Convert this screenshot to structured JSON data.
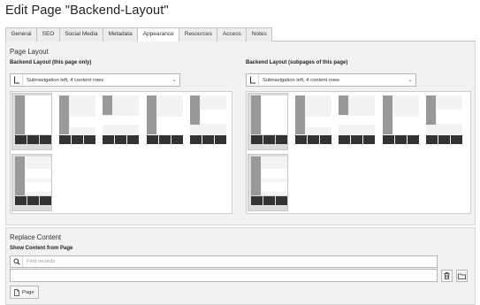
{
  "page": {
    "title": "Edit Page \"Backend-Layout\""
  },
  "tabs": [
    {
      "label": "General",
      "active": false
    },
    {
      "label": "SEO",
      "active": false
    },
    {
      "label": "Social Media",
      "active": false
    },
    {
      "label": "Metadata",
      "active": false
    },
    {
      "label": "Appearance",
      "active": true
    },
    {
      "label": "Resources",
      "active": false
    },
    {
      "label": "Access",
      "active": false
    },
    {
      "label": "Notes",
      "active": false
    }
  ],
  "page_layout": {
    "section_title": "Page Layout",
    "this_page": {
      "label": "Backend Layout (this page only)",
      "selected": "Subnavigation left, 4 content rows"
    },
    "subpages": {
      "label": "Backend Layout (subpages of this page)",
      "selected": "Subnavigation left, 4 content rows"
    }
  },
  "replace_content": {
    "section_title": "Replace Content",
    "field_label": "Show Content from Page",
    "search_placeholder": "Find records",
    "page_button_label": "Page"
  },
  "icons": {
    "layout": "backend-layout-icon",
    "chevron": "chevron-down-icon",
    "search": "search-icon",
    "delete": "trash-icon",
    "browse": "folder-icon",
    "page": "page-icon"
  },
  "colors": {
    "panel_background": "#f2f2f2",
    "thumbnail_grey": "#999999",
    "thumbnail_dark": "#333333",
    "selected_tile": "#dcdcdc"
  }
}
